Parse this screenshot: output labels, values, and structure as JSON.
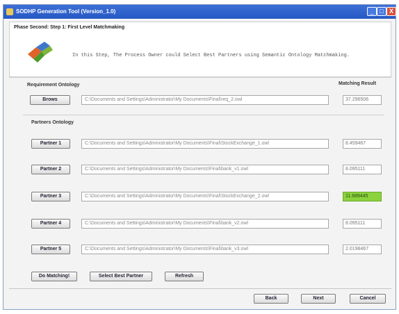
{
  "window": {
    "title": "SODHP Generation Tool (Version_1.0)",
    "min_glyph": "_",
    "max_glyph": "□",
    "close_glyph": "X"
  },
  "header": {
    "phase_title": "Phase Second: Step 1: First Level Matchmaking",
    "description": "In this Step, The Process Owner could Select Best Partners using Semantic Ontology Matchmaking."
  },
  "requirement": {
    "section_label": "Requirement Ontology",
    "result_header": "Matching Result",
    "browse_label": "Brows",
    "path": "C:\\Documents and Settings\\Administrator\\My Documents\\Final\\req_2.owl",
    "result": "37.296506"
  },
  "partners": {
    "section_label": "Partners Ontology",
    "items": [
      {
        "label": "Partner 1",
        "path": "C:\\Documents and Settings\\Administrator\\My Documents\\Final\\StockExchange_1.owl",
        "result": "8.459467",
        "highlight": false
      },
      {
        "label": "Partner 2",
        "path": "C:\\Documents and Settings\\Administrator\\My Documents\\Final\\bank_v1.owl",
        "result": "8.095111",
        "highlight": false
      },
      {
        "label": "Partner 3",
        "path": "C:\\Documents and Settings\\Administrator\\My Documents\\Final\\StockExchange_2.owl",
        "result": "11.689445",
        "highlight": true
      },
      {
        "label": "Partner 4",
        "path": "C:\\Documents and Settings\\Administrator\\My Documents\\Final\\bank_v2.owl",
        "result": "8.095111",
        "highlight": false
      },
      {
        "label": "Partner 5",
        "path": "C:\\Documents and Settings\\Administrator\\My Documents\\Final\\bank_v3.owl",
        "result": "2.0198467",
        "highlight": false
      }
    ]
  },
  "actions": {
    "do_matching": "Do Matching!",
    "select_best": "Select Best Partner",
    "refresh": "Refresh"
  },
  "nav": {
    "back": "Back",
    "next": "Next",
    "cancel": "Cancel"
  },
  "colors": {
    "titlebar": "#2e62cc",
    "highlight_result": "#8bd23c"
  }
}
